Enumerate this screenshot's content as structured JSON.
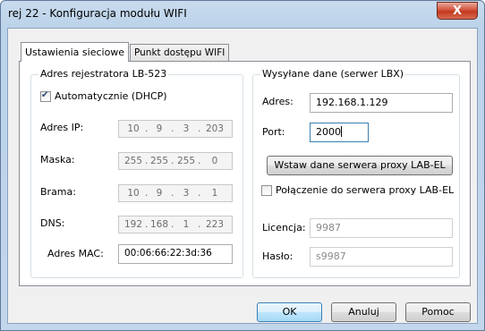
{
  "window": {
    "title": "rej 22 - Konfiguracja modułu WIFI",
    "close_label": "X"
  },
  "tabs": [
    {
      "label": "Ustawienia sieciowe"
    },
    {
      "label": "Punkt dostępu WIFI"
    }
  ],
  "recorder_group": {
    "title": "Adres rejestratora LB-523",
    "dhcp_label": "Automatycznie (DHCP)",
    "dhcp_checked": true,
    "ip": {
      "label": "Adres IP:",
      "octets": [
        "10",
        "9",
        "3",
        "203"
      ]
    },
    "mask": {
      "label": "Maska:",
      "octets": [
        "255",
        "255",
        "255",
        "0"
      ]
    },
    "gateway": {
      "label": "Brama:",
      "octets": [
        "10",
        "9",
        "3",
        "1"
      ]
    },
    "dns": {
      "label": "DNS:",
      "octets": [
        "192",
        "168",
        "1",
        "223"
      ]
    },
    "mac": {
      "label": "Adres MAC:",
      "value": "00:06:66:22:3d:36"
    }
  },
  "server_group": {
    "title": "Wysyłane dane (serwer LBX)",
    "address": {
      "label": "Adres:",
      "value": "192.168.1.129"
    },
    "port": {
      "label": "Port:",
      "value": "2000"
    },
    "proxy_button_label": "Wstaw dane serwera proxy LAB-EL",
    "proxy_checkbox_label": "Połączenie do serwera proxy LAB-EL",
    "proxy_checked": false,
    "license": {
      "label": "Licencja:",
      "value": "9987"
    },
    "password": {
      "label": "Hasło:",
      "value": "s9987"
    }
  },
  "buttons": {
    "ok": "OK",
    "cancel": "Anuluj",
    "help": "Pomoc"
  }
}
